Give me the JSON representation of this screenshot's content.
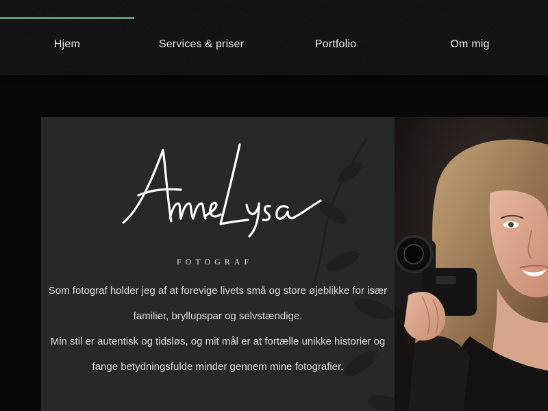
{
  "nav": {
    "accent_color": "#5e9e7e",
    "items": [
      {
        "label": "Hjem"
      },
      {
        "label": "Services & priser"
      },
      {
        "label": "Portfolio"
      },
      {
        "label": "Om mig"
      }
    ]
  },
  "hero": {
    "logo": {
      "script_text": "Anne Lysa",
      "subtitle": "FOTOGRAF"
    },
    "intro_lines": [
      "Som fotograf holder jeg af at forevige livets små og store øjeblikke for især",
      "familier, bryllupspar og selvstændige.",
      "Min stil er autentisk og tidsløs, og mit mål er at fortælle unikke historier og",
      "fange betydningsfulde minder gennem mine fotografier."
    ],
    "photo_icon": "photographer-portrait-image"
  },
  "colors": {
    "background": "#080808",
    "panel": "#282828",
    "text": "#dcdcdc"
  }
}
